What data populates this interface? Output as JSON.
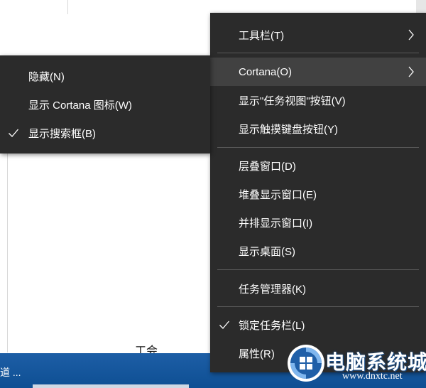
{
  "background": {
    "peek_text": "工会",
    "taskbar_search_text": "道 ..."
  },
  "main_menu": {
    "items": [
      {
        "label": "工具栏(T)",
        "submenu": true,
        "checked": false
      },
      {
        "label": "Cortana(O)",
        "submenu": true,
        "checked": false,
        "highlighted": true
      },
      {
        "label": "显示\"任务视图\"按钮(V)",
        "submenu": false,
        "checked": false
      },
      {
        "label": "显示触摸键盘按钮(Y)",
        "submenu": false,
        "checked": false
      },
      {
        "label": "层叠窗口(D)",
        "submenu": false,
        "checked": false
      },
      {
        "label": "堆叠显示窗口(E)",
        "submenu": false,
        "checked": false
      },
      {
        "label": "并排显示窗口(I)",
        "submenu": false,
        "checked": false
      },
      {
        "label": "显示桌面(S)",
        "submenu": false,
        "checked": false
      },
      {
        "label": "任务管理器(K)",
        "submenu": false,
        "checked": false
      },
      {
        "label": "锁定任务栏(L)",
        "submenu": false,
        "checked": true
      },
      {
        "label": "属性(R)",
        "submenu": false,
        "checked": false
      }
    ]
  },
  "cortana_submenu": {
    "items": [
      {
        "label": "隐藏(N)",
        "checked": false
      },
      {
        "label": "显示 Cortana 图标(W)",
        "checked": false
      },
      {
        "label": "显示搜索框(B)",
        "checked": true
      }
    ]
  },
  "watermark": {
    "brand": "电脑系统城",
    "site": "www.dnxtc.net"
  },
  "colors": {
    "menu_bg": "#2b2b2b",
    "menu_highlight": "#414141",
    "separator": "#595959",
    "taskbar": "#0e4f93"
  }
}
